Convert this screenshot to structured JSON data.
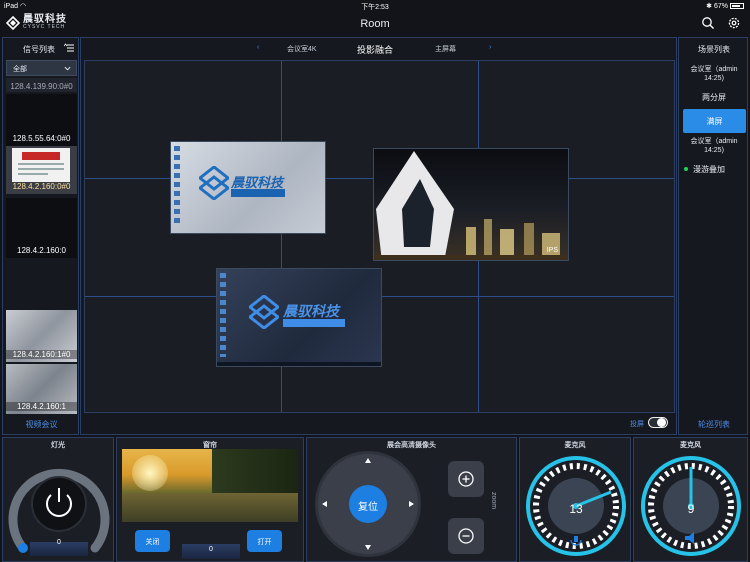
{
  "status": {
    "device": "iPad",
    "time": "下午2:53",
    "battery": "67%"
  },
  "nav": {
    "logo_cn": "晨驭科技",
    "logo_en": "CYSVC TECH",
    "title": "Room"
  },
  "signals": {
    "title": "信号列表",
    "filter": "全部",
    "items": [
      {
        "label": "128.4.139.90:0#0"
      },
      {
        "label": "128.5.55.64:0#0"
      },
      {
        "label": "128.4.2.160:0#0"
      },
      {
        "label": "128.4.2.160:0"
      },
      {
        "label": "128.4.2.160:1#0"
      },
      {
        "label": "128.4.2.160:1"
      }
    ],
    "footer": "视频会议"
  },
  "center": {
    "tab_left": "会议室4K",
    "tab_active": "投影融合",
    "tab_right": "主屏幕",
    "prev": "‹",
    "next": "›",
    "projection_label": "投屏",
    "projection_on": true,
    "windows": [
      {
        "name": "desktop-logo-window",
        "overlay": "晨驭科技"
      },
      {
        "name": "building-night-window",
        "overlay": "IPS"
      },
      {
        "name": "desktop-blue-window",
        "overlay": "晨驭科技"
      }
    ]
  },
  "scenes": {
    "title": "场景列表",
    "items": [
      {
        "label": "会议室（admin 14:25)"
      },
      {
        "label": "两分屏"
      },
      {
        "label": "满屏"
      },
      {
        "label": "会议室（admin 14:25)"
      },
      {
        "label": "漫游叠加"
      }
    ],
    "footer": "轮巡列表"
  },
  "light": {
    "title": "灯光",
    "value": "0",
    "level": 0
  },
  "curtain": {
    "title": "窗帘",
    "close": "关闭",
    "open": "打开",
    "value": "0"
  },
  "camera": {
    "title": "展会高清摄像头",
    "reset": "复位",
    "zoom": "zoom"
  },
  "mic1": {
    "title": "麦克风",
    "value": "13",
    "level": 0.13
  },
  "mic2": {
    "title": "麦克风",
    "value": "9",
    "level": 0.09
  },
  "colors": {
    "accent": "#1e7fe3",
    "gauge": "#27c2e8",
    "grid": "#2f4f8c",
    "active_dot": "#29d05a"
  }
}
